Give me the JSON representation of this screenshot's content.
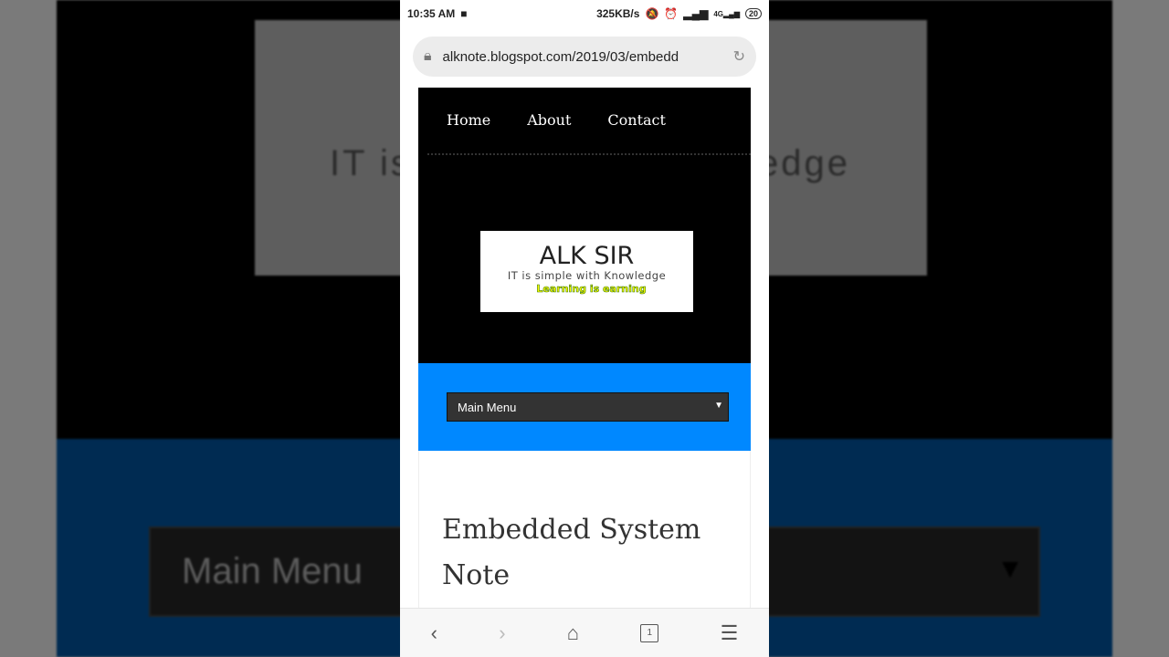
{
  "background": {
    "logo_left": "IT is",
    "logo_right": "edge",
    "menu": "Main Menu"
  },
  "status": {
    "time": "10:35 AM",
    "speed": "325KB/s",
    "battery": "20",
    "network": "4G"
  },
  "browser": {
    "url": "alknote.blogspot.com/2019/03/embedd"
  },
  "nav": {
    "items": [
      {
        "label": "Home"
      },
      {
        "label": "About"
      },
      {
        "label": "Contact"
      }
    ]
  },
  "logo": {
    "title": "ALK SIR",
    "tagline": "IT is simple with Knowledge",
    "slogan": "Learning is earning"
  },
  "menu": {
    "selected": "Main Menu"
  },
  "article": {
    "title": "Embedded System Note"
  },
  "toolbar": {
    "tabs_count": "1"
  },
  "colors": {
    "accent_blue": "#0088ff"
  }
}
